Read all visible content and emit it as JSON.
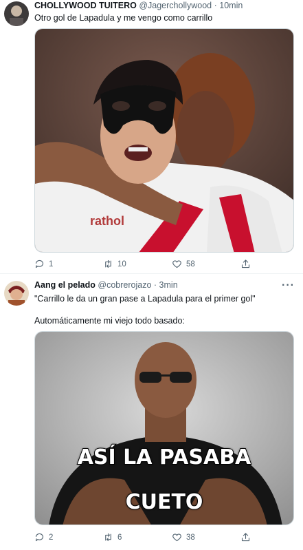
{
  "tweets": [
    {
      "name": "CHOLLYWOOD TUITERO",
      "handle": "@Jagerchollywood",
      "separator": "·",
      "time": "10min",
      "more_label": "···",
      "text_lines": [
        "Otro gol de Lapadula y me vengo como carrillo"
      ],
      "media_overlay": "",
      "actions": {
        "reply": "1",
        "retweet": "10",
        "like": "58"
      }
    },
    {
      "name": "Aang el pelado",
      "handle": "@cobrerojazo",
      "separator": "·",
      "time": "3min",
      "more_label": "···",
      "text_lines": [
        "\"Carrillo le da un gran pase a Lapadula para el primer gol\"",
        "",
        "Automáticamente mi viejo todo basado:"
      ],
      "media_overlay": [
        "ASÍ LA PASABA",
        "CUETO"
      ],
      "actions": {
        "reply": "2",
        "retweet": "6",
        "like": "38"
      }
    }
  ],
  "icons": {
    "reply": "reply-icon",
    "retweet": "retweet-icon",
    "like": "heart-icon",
    "share": "share-icon"
  },
  "colors": {
    "text": "#0f1419",
    "secondary": "#536471",
    "border": "#cfd9de",
    "accent_red": "#c8102e"
  }
}
